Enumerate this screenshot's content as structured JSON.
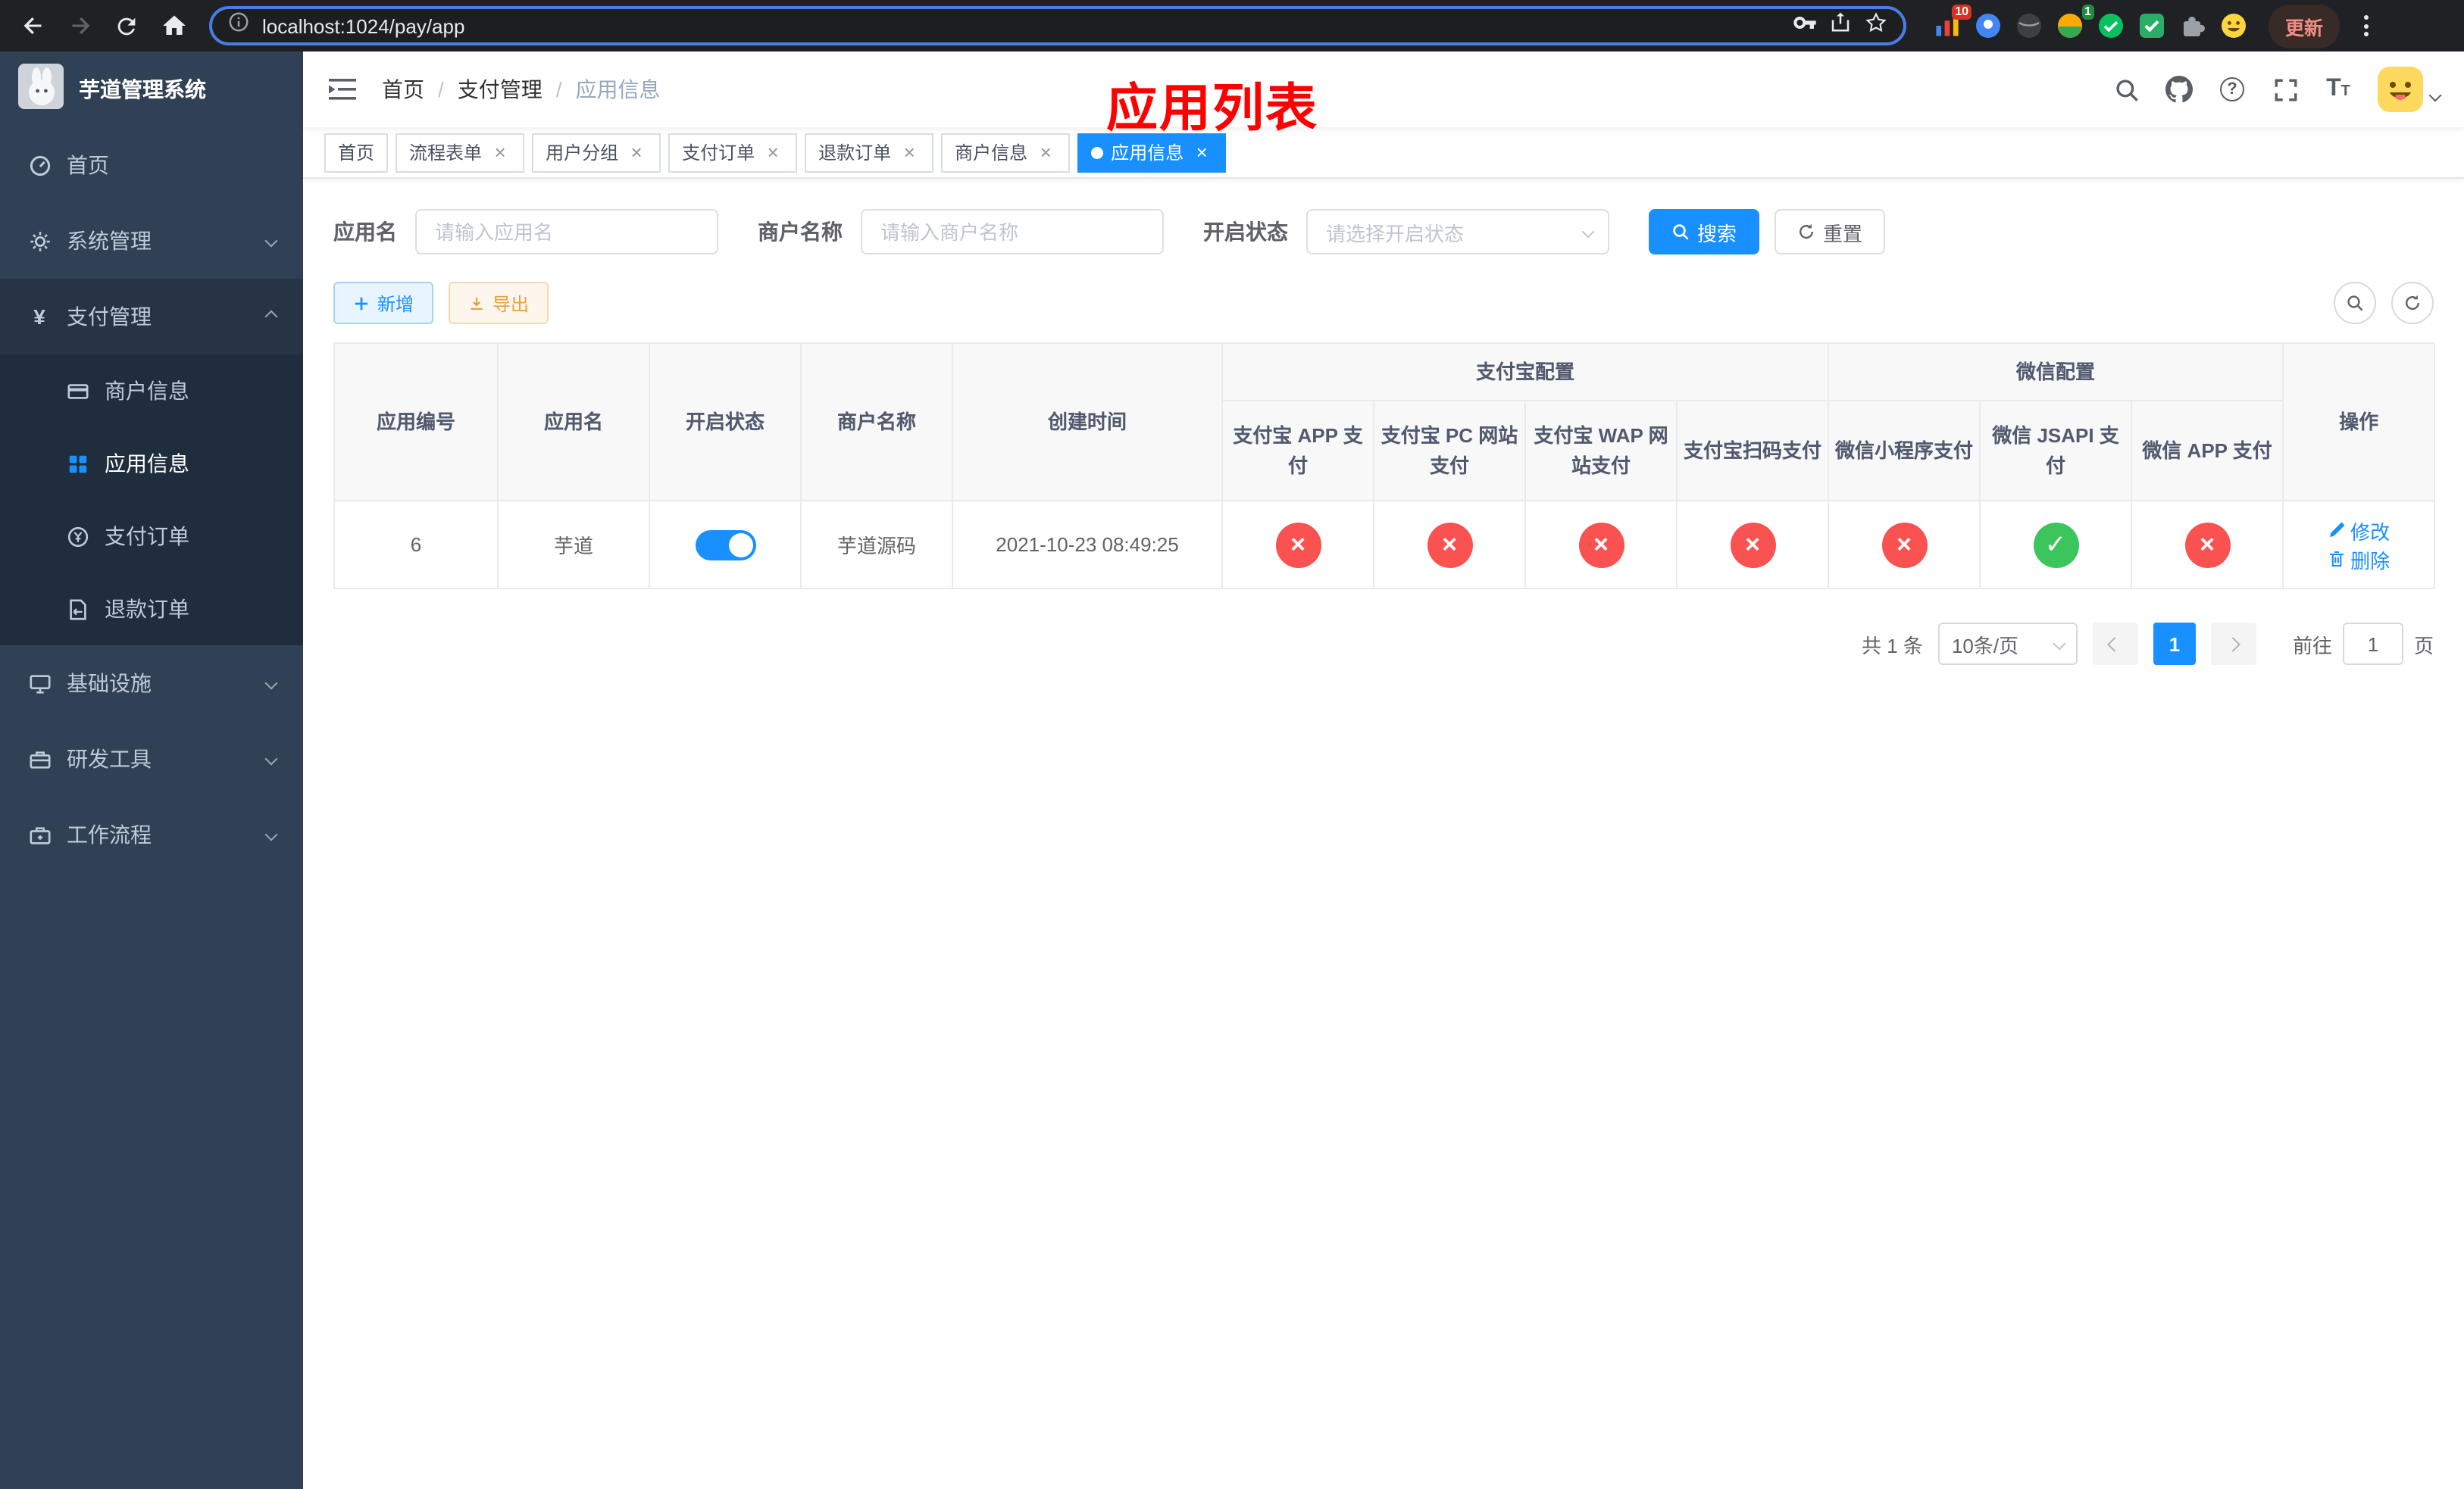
{
  "theme": {
    "primary": "#1890ff",
    "success": "#3cc55b",
    "danger": "#fa5151",
    "warning": "#e6a23c",
    "annotation_red": "#ff0000",
    "sidebar_bg": "#304156",
    "sidebar_submenu_bg": "#1f2d3d"
  },
  "icons": {
    "cross": "×",
    "check": "✓",
    "close": "×",
    "question": "?",
    "font_big": "T",
    "font_small": "T",
    "yen": "¥"
  },
  "browser": {
    "url": "localhost:1024/pay/app",
    "update_label": "更新",
    "grid_ext_badge": "10",
    "avatar_ext_badge": "1"
  },
  "sidebar": {
    "logo_title": "芋道管理系统",
    "home": "首页",
    "system_mgmt": "系统管理",
    "payment_mgmt": "支付管理",
    "merchant_info": "商户信息",
    "app_info": "应用信息",
    "payment_order": "支付订单",
    "refund_order": "退款订单",
    "infrastructure": "基础设施",
    "dev_tools": "研发工具",
    "workflow": "工作流程"
  },
  "navbar": {
    "breadcrumb": {
      "home": "首页",
      "payment": "支付管理",
      "current": "应用信息",
      "sep": "/"
    },
    "overlay_title": "应用列表"
  },
  "tags": {
    "home": "首页",
    "process_form": "流程表单",
    "user_group": "用户分组",
    "payment_order": "支付订单",
    "refund_order": "退款订单",
    "merchant_info": "商户信息",
    "app_info": "应用信息"
  },
  "filter": {
    "app_name_label": "应用名",
    "app_name_placeholder": "请输入应用名",
    "merchant_label": "商户名称",
    "merchant_placeholder": "请输入商户名称",
    "status_label": "开启状态",
    "status_placeholder": "请选择开启状态",
    "search_label": "搜索",
    "reset_label": "重置"
  },
  "toolbar": {
    "add_label": "新增",
    "export_label": "导出"
  },
  "table": {
    "headers": {
      "app_id": "应用编号",
      "app_name": "应用名",
      "status": "开启状态",
      "merchant_name": "商户名称",
      "create_time": "创建时间",
      "alipay_group": "支付宝配置",
      "wechat_group": "微信配置",
      "alipay_app": "支付宝 APP 支付",
      "alipay_pc": "支付宝 PC 网站支付",
      "alipay_wap": "支付宝 WAP 网站支付",
      "alipay_scan": "支付宝扫码支付",
      "wechat_lite": "微信小程序支付",
      "wechat_jsapi": "微信 JSAPI 支付",
      "wechat_app": "微信 APP 支付",
      "actions": "操作"
    },
    "row": {
      "app_id": "6",
      "app_name": "芋道",
      "merchant_name": "芋道源码",
      "create_time": "2021-10-23 08:49:25",
      "edit_label": "修改",
      "delete_label": "删除"
    }
  },
  "pagination": {
    "total": "共 1 条",
    "page_size": "10条/页",
    "page": "1",
    "goto_prefix": "前往",
    "goto_value": "1",
    "goto_suffix": "页"
  }
}
